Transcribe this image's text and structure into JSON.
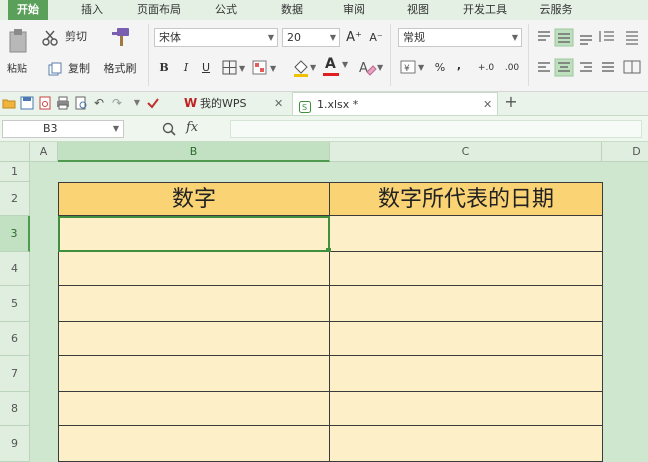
{
  "menu": {
    "tabs": [
      "开始",
      "插入",
      "页面布局",
      "公式",
      "数据",
      "审阅",
      "视图",
      "开发工具",
      "云服务"
    ],
    "active": "开始"
  },
  "ribbon": {
    "paste": "粘贴",
    "cut": "剪切",
    "copy": "复制",
    "format_painter": "格式刷",
    "font_name": "宋体",
    "font_size": "20",
    "bold": "B",
    "italic": "I",
    "underline": "U",
    "grow_font": "A⁺",
    "shrink_font": "A⁻",
    "font_color_letter": "A",
    "number_format": "常规",
    "percent": "%",
    "thousands": ",",
    "inc_decimal": "+.0",
    "dec_decimal": ".00"
  },
  "doc_tabs": {
    "wps_label": "我的WPS",
    "file_label": "1.xlsx *"
  },
  "formula_bar": {
    "cell_ref": "B3",
    "fx": "fx",
    "content": ""
  },
  "sheet": {
    "columns": [
      "A",
      "B",
      "C",
      "D"
    ],
    "rows": [
      "1",
      "2",
      "3",
      "4",
      "5",
      "6",
      "7",
      "8",
      "9"
    ],
    "selected_column": "B",
    "selected_row": "3",
    "header_b2": "数字",
    "header_c2": "数字所代表的日期"
  },
  "colors": {
    "menu_active": "#5aa05a",
    "header_fill": "#f9d374",
    "body_fill": "#fdefc8",
    "selection": "#3f8f3f",
    "background": "#cfe6cf"
  }
}
